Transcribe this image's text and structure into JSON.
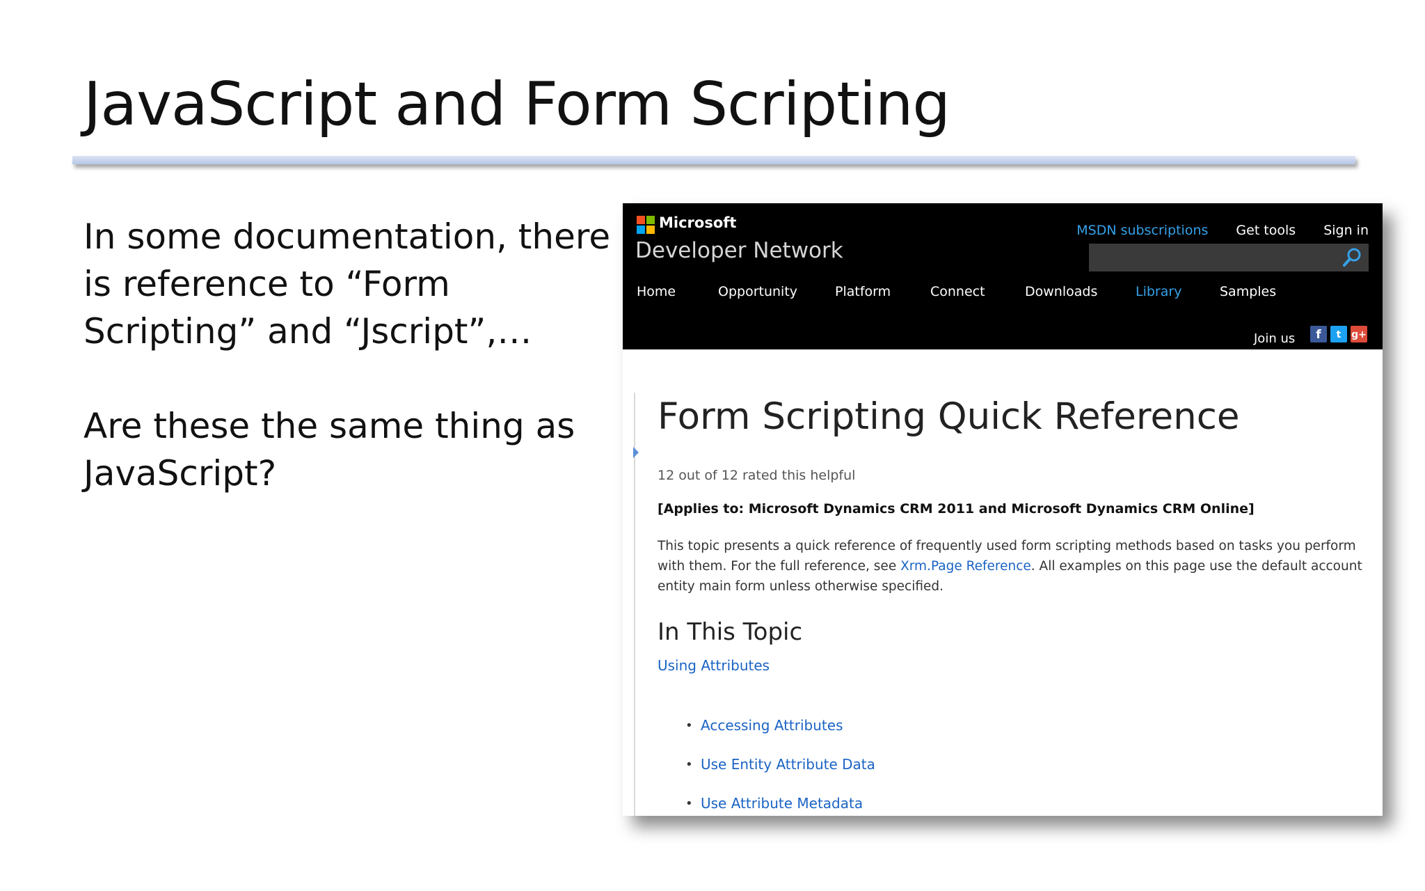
{
  "slide": {
    "title": "JavaScript and Form Scripting",
    "paragraph1": "In some documentation, there is reference to “Form Scripting” and “Jscript”,…",
    "paragraph2": "Are these the same thing as JavaScript?"
  },
  "screenshot": {
    "header": {
      "brand": "Microsoft",
      "site_name": "Developer Network",
      "top_links": [
        "MSDN subscriptions",
        "Get tools",
        "Sign in"
      ],
      "nav": [
        "Home",
        "Opportunity",
        "Platform",
        "Connect",
        "Downloads",
        "Library",
        "Samples"
      ],
      "active_nav": "Library",
      "join_us": "Join us",
      "social": [
        "f",
        "t",
        "g+"
      ]
    },
    "article": {
      "title": "Form Scripting Quick Reference",
      "rating": "12 out of 12 rated this helpful",
      "applies_to": "[Applies to: Microsoft Dynamics CRM 2011 and Microsoft Dynamics CRM Online]",
      "intro_before": "This topic presents a quick reference of frequently used form scripting methods based on tasks you perform with them. For the full reference, see ",
      "intro_link": "Xrm.Page Reference",
      "intro_after": ". All examples on this page use the default account entity main form unless otherwise specified.",
      "section_heading": "In This Topic",
      "section_link": "Using Attributes",
      "sub_links": [
        "Accessing Attributes",
        "Use Entity Attribute Data",
        "Use Attribute Metadata"
      ]
    }
  },
  "colors": {
    "header_bg": "#000000",
    "accent_link": "#35a1e8",
    "body_link": "#1a63c4"
  }
}
